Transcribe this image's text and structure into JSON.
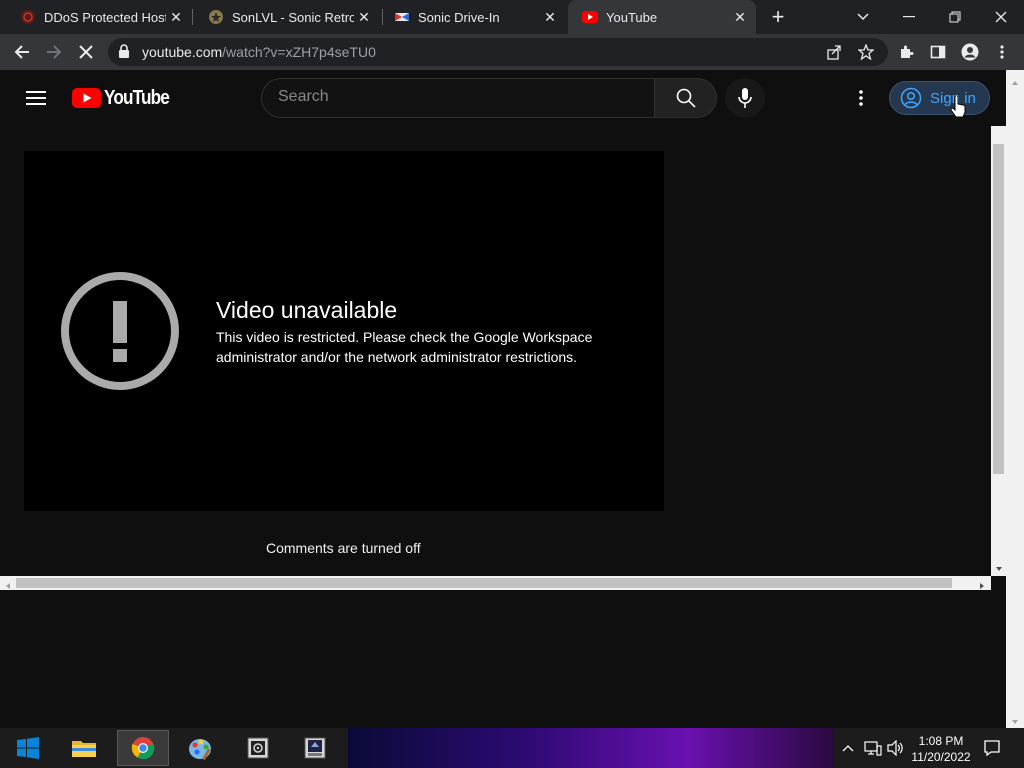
{
  "browser": {
    "tabs": [
      {
        "title": "DDoS Protected Hostin",
        "icon": "ddos-favicon-icon"
      },
      {
        "title": "SonLVL - Sonic Retro",
        "icon": "sonic-retro-favicon-icon"
      },
      {
        "title": "Sonic Drive-In",
        "icon": "sonic-drivein-favicon-icon"
      },
      {
        "title": "YouTube",
        "icon": "youtube-favicon-icon",
        "active": true
      }
    ],
    "new_tab_label": "+",
    "url_host": "youtube.com",
    "url_path": "/watch?v=xZH7p4seTU0"
  },
  "youtube": {
    "logo_text": "YouTube",
    "search_placeholder": "Search",
    "sign_in_label": "Sign in",
    "error_title": "Video unavailable",
    "error_message": "This video is restricted. Please check the Google Workspace administrator and/or the network administrator restrictions.",
    "comments_status": "Comments are turned off"
  },
  "taskbar": {
    "time": "1:08 PM",
    "date": "11/20/2022"
  },
  "colors": {
    "youtube_red": "#ff0000",
    "signin_blue": "#3ea6ff",
    "page_bg": "#0f0f0f"
  }
}
